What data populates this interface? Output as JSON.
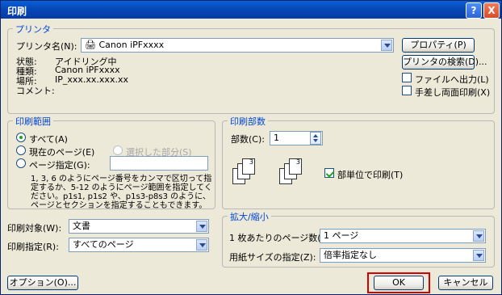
{
  "title": "印刷",
  "titlebar": {
    "help_label": "?",
    "close_label": "X"
  },
  "printer": {
    "legend": "プリンタ",
    "name_label": "プリンタ名(N):",
    "name_value": "Canon iPFxxxx",
    "status_label": "状態:",
    "status_value": "アイドリング中",
    "type_label": "種類:",
    "type_value": "Canon iPFxxxx",
    "where_label": "場所:",
    "where_value": "IP_xxx.xx.xxx.xx",
    "comment_label": "コメント:",
    "properties_button": "プロパティ(P)",
    "find_printer_button": "プリンタの検索(D)...",
    "print_to_file_label": "ファイルへ出力(L)",
    "manual_duplex_label": "手差し両面印刷(X)",
    "print_to_file_checked": false,
    "manual_duplex_checked": false
  },
  "range": {
    "legend": "印刷範囲",
    "all_label": "すべて(A)",
    "current_label": "現在のページ(E)",
    "selection_label": "選択した部分(S)",
    "pages_label": "ページ指定(G):",
    "selected": "all",
    "note_lines": [
      "1, 3, 6 のようにページ番号をカンマで区切って指",
      "定するか、5-12 のようにページ範囲を指定してく",
      "ださい。p1s1, p1s2 や、p1s3-p8s3 のように、",
      "ページとセクションを指定することもできます。"
    ]
  },
  "copies": {
    "legend": "印刷部数",
    "count_label": "部数(C):",
    "count_value": "1",
    "collate_label": "部単位で印刷(T)",
    "collate_checked": true,
    "page_glyphs": [
      "1",
      "2",
      "3"
    ]
  },
  "print_what": {
    "label": "印刷対象(W):",
    "value": "文書"
  },
  "print_spec": {
    "label": "印刷指定(R):",
    "value": "すべてのページ"
  },
  "zoom": {
    "legend": "拡大/縮小",
    "pages_per_sheet_label": "1 枚あたりのページ数(H):",
    "pages_per_sheet_value": "1 ページ",
    "scale_label": "用紙サイズの指定(Z):",
    "scale_value": "倍率指定なし"
  },
  "footer": {
    "options_button": "オプション(O)...",
    "ok_button": "OK",
    "cancel_button": "キャンセル"
  },
  "colors": {
    "accent": "#0046d5",
    "highlight": "#d40000"
  }
}
